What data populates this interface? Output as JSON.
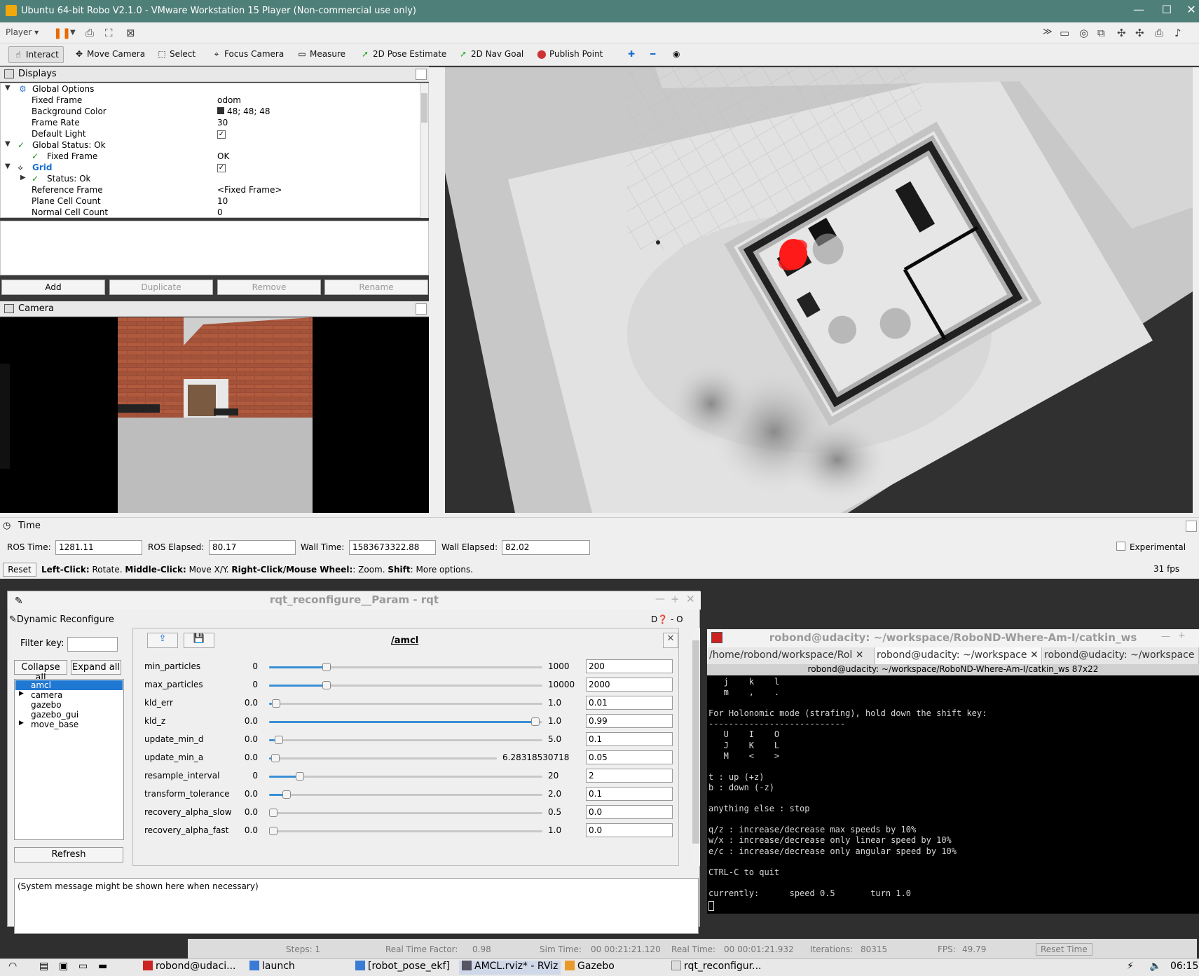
{
  "vm": {
    "title": "Ubuntu 64-bit Robo V2.1.0 - VMware Workstation 15 Player (Non-commercial use only)",
    "player_menu": "Player"
  },
  "rviz": {
    "tools": [
      "Interact",
      "Move Camera",
      "Select",
      "Focus Camera",
      "Measure",
      "2D Pose Estimate",
      "2D Nav Goal",
      "Publish Point"
    ],
    "displays_title": "Displays",
    "tree": [
      {
        "label": "Global Options",
        "value": ""
      },
      {
        "label": "Fixed Frame",
        "value": "odom"
      },
      {
        "label": "Background Color",
        "value": "48; 48; 48"
      },
      {
        "label": "Frame Rate",
        "value": "30"
      },
      {
        "label": "Default Light",
        "value": ""
      },
      {
        "label": "Global Status: Ok",
        "value": ""
      },
      {
        "label": "Fixed Frame",
        "value": "OK"
      },
      {
        "label": "Grid",
        "value": ""
      },
      {
        "label": "Status: Ok",
        "value": ""
      },
      {
        "label": "Reference Frame",
        "value": "<Fixed Frame>"
      },
      {
        "label": "Plane Cell Count",
        "value": "10"
      },
      {
        "label": "Normal Cell Count",
        "value": "0"
      }
    ],
    "buttons": {
      "add": "Add",
      "duplicate": "Duplicate",
      "remove": "Remove",
      "rename": "Rename"
    },
    "camera_title": "Camera",
    "time_title": "Time",
    "time": {
      "ros_time_label": "ROS Time:",
      "ros_time": "1281.11",
      "ros_elapsed_label": "ROS Elapsed:",
      "ros_elapsed": "80.17",
      "wall_time_label": "Wall Time:",
      "wall_time": "1583673322.88",
      "wall_elapsed_label": "Wall Elapsed:",
      "wall_elapsed": "82.02",
      "experimental": "Experimental"
    },
    "status": {
      "reset": "Reset",
      "hint_b1": "Left-Click:",
      "hint_t1": " Rotate. ",
      "hint_b2": "Middle-Click:",
      "hint_t2": " Move X/Y. ",
      "hint_b3": "Right-Click/Mouse Wheel:",
      "hint_t3": ": Zoom. ",
      "hint_b4": "Shift",
      "hint_t4": ": More options.",
      "fps": "31 fps"
    }
  },
  "rqt": {
    "title": "rqt_reconfigure__Param - rqt",
    "plugin": "Dynamic Reconfigure",
    "filter_label": "Filter key:",
    "collapse": "Collapse all",
    "expand": "Expand all",
    "nodes": [
      "amcl",
      "camera",
      "gazebo",
      "gazebo_gui",
      "move_base"
    ],
    "refresh": "Refresh",
    "node_title": "/amcl",
    "params": [
      {
        "name": "min_particles",
        "min": "0",
        "max": "1000",
        "value": "200",
        "frac": 0.2
      },
      {
        "name": "max_particles",
        "min": "0",
        "max": "10000",
        "value": "2000",
        "frac": 0.2
      },
      {
        "name": "kld_err",
        "min": "0.0",
        "max": "1.0",
        "value": "0.01",
        "frac": 0.01
      },
      {
        "name": "kld_z",
        "min": "0.0",
        "max": "1.0",
        "value": "0.99",
        "frac": 0.99
      },
      {
        "name": "update_min_d",
        "min": "0.0",
        "max": "5.0",
        "value": "0.1",
        "frac": 0.02
      },
      {
        "name": "update_min_a",
        "min": "0.0",
        "max": "6.28318530718",
        "value": "0.05",
        "frac": 0.008
      },
      {
        "name": "resample_interval",
        "min": "0",
        "max": "20",
        "value": "2",
        "frac": 0.1
      },
      {
        "name": "transform_tolerance",
        "min": "0.0",
        "max": "2.0",
        "value": "0.1",
        "frac": 0.05
      },
      {
        "name": "recovery_alpha_slow",
        "min": "0.0",
        "max": "0.5",
        "value": "0.0",
        "frac": 0.0
      },
      {
        "name": "recovery_alpha_fast",
        "min": "0.0",
        "max": "1.0",
        "value": "0.0",
        "frac": 0.0
      }
    ],
    "message": "(System message might be shown here when necessary)"
  },
  "terminal": {
    "title": "robond@udacity: ~/workspace/RoboND-Where-Am-I/catkin_ws",
    "tabs": [
      "/home/robond/workspace/Rol",
      "robond@udacity: ~/workspace",
      "robond@udacity: ~/workspace"
    ],
    "subtitle": "robond@udacity: ~/workspace/RoboND-Where-Am-I/catkin_ws 87x22",
    "lines": [
      "   j    k    l",
      "   m    ,    .",
      "",
      "For Holonomic mode (strafing), hold down the shift key:",
      "---------------------------",
      "   U    I    O",
      "   J    K    L",
      "   M    <    >",
      "",
      "t : up (+z)",
      "b : down (-z)",
      "",
      "anything else : stop",
      "",
      "q/z : increase/decrease max speeds by 10%",
      "w/x : increase/decrease only linear speed by 10%",
      "e/c : increase/decrease only angular speed by 10%",
      "",
      "CTRL-C to quit",
      "",
      "currently:      speed 0.5       turn 1.0"
    ]
  },
  "gazebo_bar": {
    "steps": "Steps: 1",
    "rtf": "Real Time Factor:",
    "rtf_val": "0.98",
    "sim": "Sim Time:",
    "sim_val": "00 00:21:21.120",
    "real": "Real Time:",
    "real_val": "00 00:01:21.932",
    "iter": "Iterations:",
    "iter_val": "80315",
    "fps": "FPS:",
    "fps_val": "49.79",
    "reset": "Reset Time"
  },
  "taskbar": {
    "items": [
      "robond@udaci...",
      "launch",
      "[robot_pose_ekf]",
      "AMCL.rviz* - RViz",
      "Gazebo",
      "rqt_reconfigur..."
    ],
    "clock": "06:15"
  }
}
